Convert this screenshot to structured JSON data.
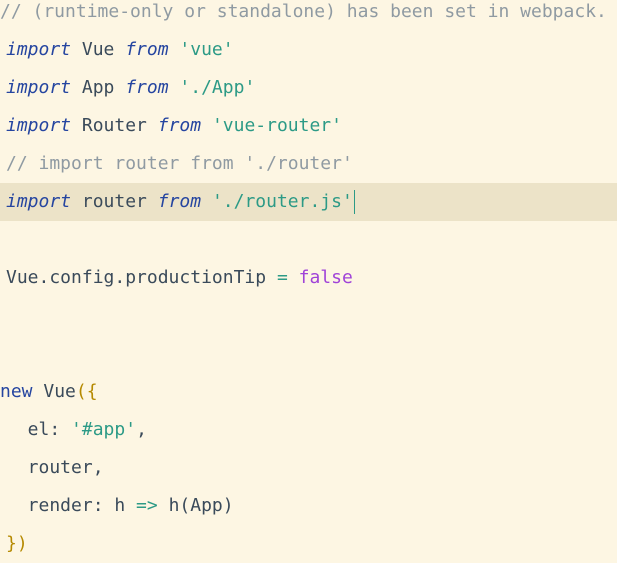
{
  "editor": {
    "lines": [
      {
        "id": "l1",
        "tokens": [
          {
            "t": "comment",
            "v": "// (runtime-only or standalone) has been set in webpack."
          }
        ]
      },
      {
        "id": "l2",
        "tokens": [
          {
            "t": "kw",
            "v": "import"
          },
          {
            "t": "ident",
            "v": " Vue "
          },
          {
            "t": "kw",
            "v": "from"
          },
          {
            "t": "ident",
            "v": " "
          },
          {
            "t": "str",
            "v": "'vue'"
          }
        ]
      },
      {
        "id": "l3",
        "tokens": [
          {
            "t": "kw",
            "v": "import"
          },
          {
            "t": "ident",
            "v": " App "
          },
          {
            "t": "kw",
            "v": "from"
          },
          {
            "t": "ident",
            "v": " "
          },
          {
            "t": "str",
            "v": "'./App'"
          }
        ]
      },
      {
        "id": "l4",
        "tokens": [
          {
            "t": "kw",
            "v": "import"
          },
          {
            "t": "ident",
            "v": " Router "
          },
          {
            "t": "kw",
            "v": "from"
          },
          {
            "t": "ident",
            "v": " "
          },
          {
            "t": "str",
            "v": "'vue-router'"
          }
        ]
      },
      {
        "id": "l5",
        "tokens": [
          {
            "t": "comment",
            "v": "// import router from './router'"
          }
        ]
      },
      {
        "id": "l6",
        "active": true,
        "tokens": [
          {
            "t": "kw",
            "v": "import"
          },
          {
            "t": "ident",
            "v": " router "
          },
          {
            "t": "kw",
            "v": "from"
          },
          {
            "t": "ident",
            "v": " "
          },
          {
            "t": "str",
            "v": "'./router.js'"
          }
        ]
      },
      {
        "id": "l7",
        "tokens": []
      },
      {
        "id": "l8",
        "tokens": [
          {
            "t": "ident",
            "v": "Vue.config.productionTip "
          },
          {
            "t": "op",
            "v": "="
          },
          {
            "t": "ident",
            "v": " "
          },
          {
            "t": "bool",
            "v": "false"
          }
        ]
      },
      {
        "id": "l9",
        "tokens": []
      },
      {
        "id": "l10",
        "tokens": []
      },
      {
        "id": "l11",
        "tokens": [
          {
            "t": "new",
            "v": "new"
          },
          {
            "t": "ident",
            "v": " Vue"
          },
          {
            "t": "punct",
            "v": "({"
          }
        ]
      },
      {
        "id": "l12",
        "tokens": [
          {
            "t": "ident",
            "v": "  el: "
          },
          {
            "t": "str",
            "v": "'#app'"
          },
          {
            "t": "ident",
            "v": ","
          }
        ]
      },
      {
        "id": "l13",
        "tokens": [
          {
            "t": "ident",
            "v": "  router,"
          }
        ]
      },
      {
        "id": "l14",
        "tokens": [
          {
            "t": "ident",
            "v": "  render: h "
          },
          {
            "t": "op",
            "v": "=>"
          },
          {
            "t": "ident",
            "v": " h(App)"
          }
        ]
      },
      {
        "id": "l15",
        "tokens": [
          {
            "t": "punct",
            "v": "})"
          }
        ]
      }
    ]
  }
}
